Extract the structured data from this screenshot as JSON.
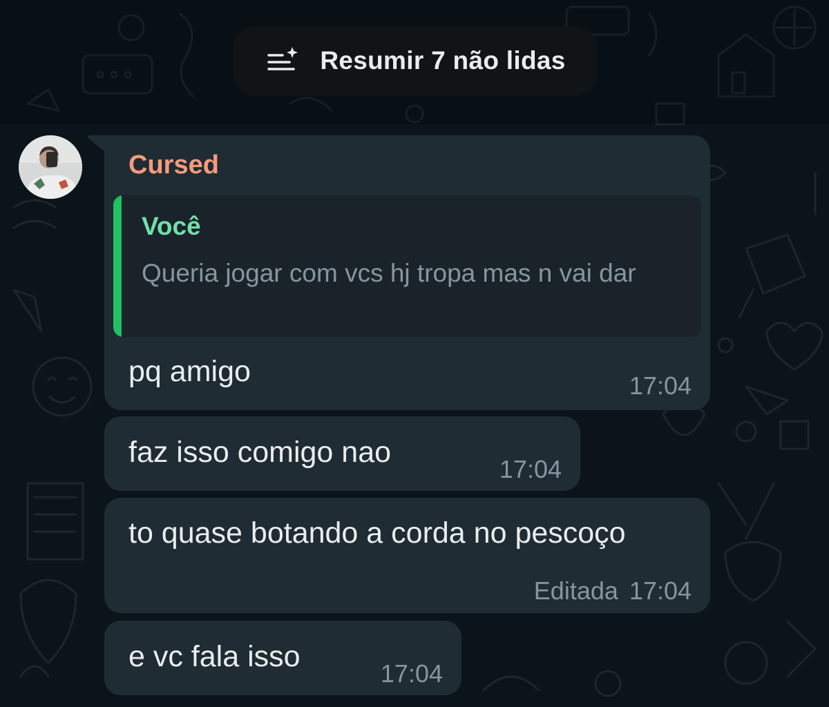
{
  "unread_summary": {
    "label": "Resumir 7 não lidas",
    "icon": "summarize-sparkle-icon"
  },
  "colors": {
    "background": "#0b141a",
    "bubble_incoming": "#1f2c33",
    "sender_name": "#f59c7c",
    "quote_author": "#71e0a9",
    "quote_bar": "#21c063",
    "meta_text": "#8696a0",
    "primary_text": "#e9edef"
  },
  "messages": [
    {
      "sender": "Cursed",
      "avatar": "avatar",
      "reply_to": {
        "author": "Você",
        "text": "Queria jogar com vcs hj tropa mas n vai dar"
      },
      "text": "pq amigo",
      "time": "17:04"
    },
    {
      "text": "faz isso comigo nao",
      "time": "17:04"
    },
    {
      "text": "to quase botando a corda  no pescoço",
      "edited_label": "Editada",
      "time": "17:04"
    },
    {
      "text": "e vc fala isso",
      "time": "17:04"
    }
  ]
}
